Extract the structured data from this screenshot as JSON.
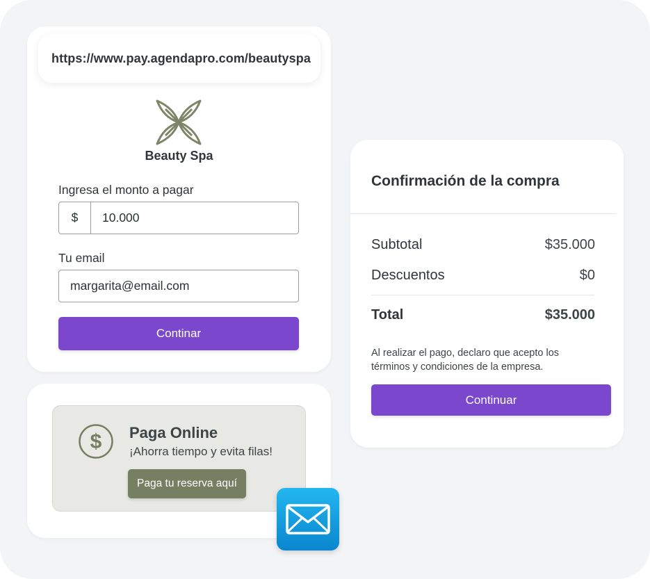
{
  "payment_card": {
    "url": "https://www.pay.agendapro.com/beautyspa",
    "brand_name": "Beauty Spa",
    "amount_label": "Ingresa el monto a pagar",
    "currency_symbol": "$",
    "amount_value": "10.000",
    "email_label": "Tu email",
    "email_value": "margarita@email.com",
    "submit_label": "Continar"
  },
  "online_card": {
    "title": "Paga Online",
    "subtitle": "¡Ahorra tiempo y evita filas!",
    "button_label": "Paga tu reserva aquí"
  },
  "confirm_card": {
    "title": "Confirmación de la compra",
    "subtotal_label": "Subtotal",
    "subtotal_value": "$35.000",
    "discount_label": "Descuentos",
    "discount_value": "$0",
    "total_label": "Total",
    "total_value": "$35.000",
    "terms_text": "Al realizar el pago, declaro que acepto los términos y condiciones de la empresa.",
    "button_label": "Continuar"
  },
  "colors": {
    "background": "#f3f4f6",
    "accent_purple": "#7b47cc",
    "olive": "#767f62",
    "mail_blue": "#0a86cf"
  },
  "icons": {
    "brand_logo": "leaf-flower-logo",
    "dollar": "dollar-circle-icon",
    "mail": "mail-icon"
  }
}
